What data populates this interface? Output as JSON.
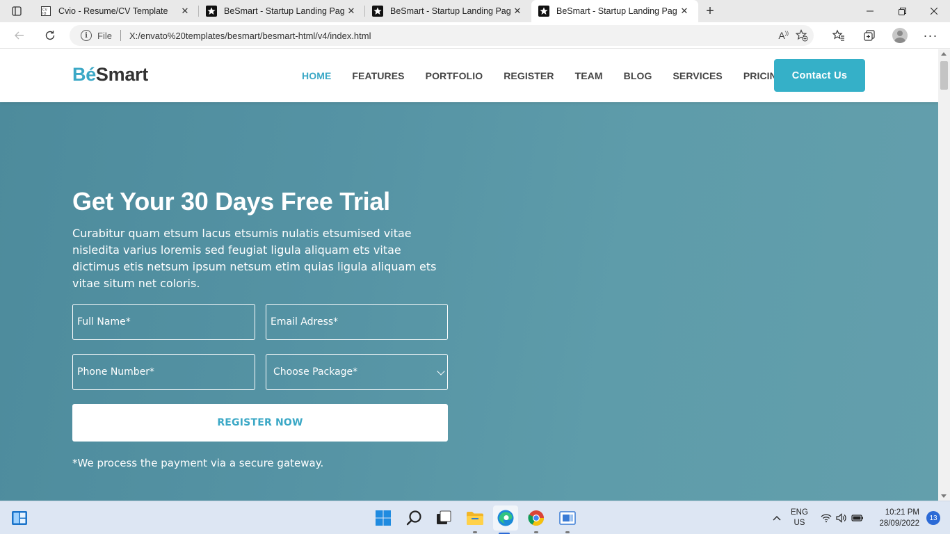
{
  "browser": {
    "tabs": [
      {
        "title": "Cvio - Resume/CV Template",
        "favicon": "cvio-logo-icon",
        "active": false
      },
      {
        "title": "BeSmart - Startup Landing Page",
        "favicon": "star-icon",
        "active": false
      },
      {
        "title": "BeSmart - Startup Landing Page",
        "favicon": "star-icon",
        "active": false
      },
      {
        "title": "BeSmart - Startup Landing Page",
        "favicon": "star-icon",
        "active": true
      }
    ],
    "address": {
      "scheme_label": "File",
      "url": "X:/envato%20templates/besmart/besmart-html/v4/index.html"
    }
  },
  "site": {
    "logo": {
      "accent": "Bé",
      "rest": "Smart"
    },
    "nav": [
      {
        "label": "HOME",
        "active": true
      },
      {
        "label": "FEATURES",
        "active": false
      },
      {
        "label": "PORTFOLIO",
        "active": false
      },
      {
        "label": "REGISTER",
        "active": false
      },
      {
        "label": "TEAM",
        "active": false
      },
      {
        "label": "BLOG",
        "active": false
      },
      {
        "label": "SERVICES",
        "active": false
      },
      {
        "label": "PRICING",
        "active": false
      }
    ],
    "contact_button": "Contact Us",
    "hero": {
      "title": "Get Your 30 Days Free Trial",
      "lead": "Curabitur quam etsum lacus etsumis nulatis etsumised vitae nisledita varius loremis sed feugiat ligula aliquam ets vitae dictimus etis netsum ipsum netsum etim quias ligula aliquam ets vitae situm net coloris.",
      "form": {
        "full_name_placeholder": "Full Name*",
        "email_placeholder": "Email Adress*",
        "phone_placeholder": "Phone Number*",
        "package_selected": "Choose Package*",
        "submit_label": "REGISTER NOW"
      },
      "note": "*We process the payment via a secure gateway."
    }
  },
  "taskbar": {
    "language": {
      "line1": "ENG",
      "line2": "US"
    },
    "time": "10:21 PM",
    "date": "28/09/2022",
    "notification_count": "13"
  },
  "colors": {
    "accent": "#3ba8c6",
    "contact_button": "#35b0c8",
    "hero_bg": "#5593a4"
  }
}
